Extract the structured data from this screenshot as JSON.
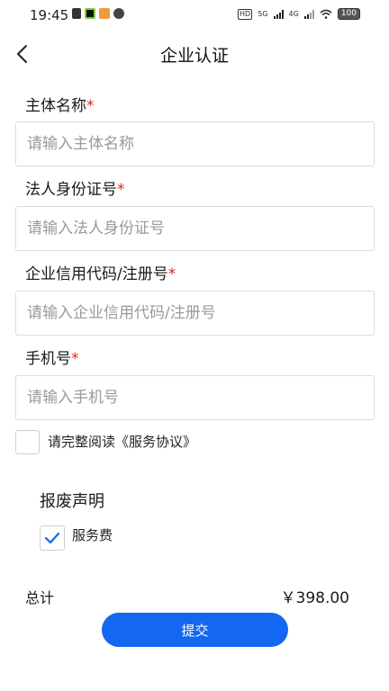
{
  "status_bar": {
    "time": "19:45",
    "network_1": "5G",
    "network_2": "4G",
    "battery": "100",
    "hd_label": "HD"
  },
  "header": {
    "title": "企业认证",
    "back_icon": "chevron-left-icon"
  },
  "form": {
    "entity_name": {
      "label": "主体名称",
      "required_mark": "*",
      "placeholder": "请输入主体名称",
      "value": ""
    },
    "legal_person_id": {
      "label": "法人身份证号",
      "required_mark": "*",
      "placeholder": "请输入法人身份证号",
      "value": ""
    },
    "credit_code": {
      "label": "企业信用代码/注册号",
      "required_mark": "*",
      "placeholder": "请输入企业信用代码/注册号",
      "value": ""
    },
    "phone": {
      "label": "手机号",
      "required_mark": "*",
      "placeholder": "请输入手机号",
      "value": ""
    }
  },
  "agreement": {
    "text": "请完整阅读《服务协议》",
    "checked": false
  },
  "section": {
    "title": "报废声明"
  },
  "fee": {
    "label": "服务费",
    "checked": true
  },
  "total": {
    "label": "总计",
    "amount": "￥398.00"
  },
  "submit": {
    "label": "提交"
  },
  "colors": {
    "accent": "#1467f0",
    "required": "#e02020"
  }
}
